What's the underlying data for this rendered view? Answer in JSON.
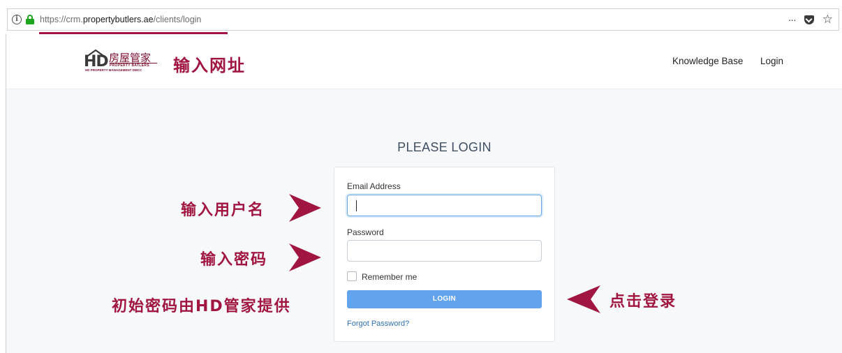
{
  "browser": {
    "url_prefix": "https://crm.",
    "url_domain": "propertybutlers.ae",
    "url_path": "/clients/login",
    "more_glyph": "···",
    "star_glyph": "☆",
    "info_glyph": "i"
  },
  "logo": {
    "letters": "HD",
    "chinese": "房屋管家",
    "tagline1": "PROPERTY BATLERS",
    "tagline2": "HD PROPERTY MANAGEMENT DMCC"
  },
  "nav": {
    "knowledge_base": "Knowledge Base",
    "login": "Login"
  },
  "annotations": {
    "enter_url": "输入网址",
    "enter_username": "输入用户名",
    "enter_password": "输入密码",
    "initial_password": "初始密码由HD管家提供",
    "click_login": "点击登录"
  },
  "login_form": {
    "title": "PLEASE LOGIN",
    "email_label": "Email Address",
    "email_value": "",
    "password_label": "Password",
    "password_value": "",
    "remember_label": "Remember me",
    "submit_label": "LOGIN",
    "forgot_label": "Forgot Password?"
  },
  "colors": {
    "annotation": "#a01640",
    "button": "#62a3ee",
    "link": "#2f6fb0"
  }
}
